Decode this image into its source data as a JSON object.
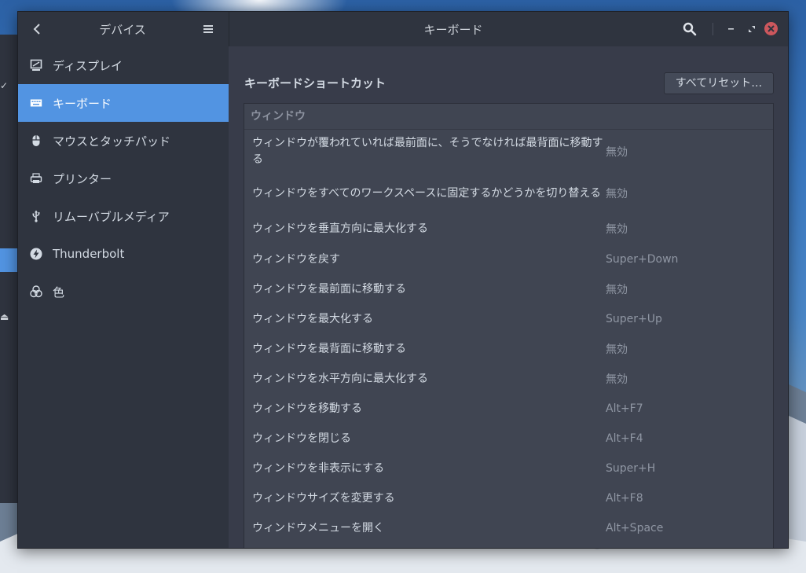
{
  "header": {
    "sidebar_title": "デバイス",
    "title": "キーボード"
  },
  "sidebar": {
    "items": [
      {
        "label": "ディスプレイ",
        "icon": "display-icon"
      },
      {
        "label": "キーボード",
        "icon": "keyboard-icon",
        "active": true
      },
      {
        "label": "マウスとタッチパッド",
        "icon": "mouse-icon"
      },
      {
        "label": "プリンター",
        "icon": "printer-icon"
      },
      {
        "label": "リムーバブルメディア",
        "icon": "usb-icon"
      },
      {
        "label": "Thunderbolt",
        "icon": "thunderbolt-icon"
      },
      {
        "label": "色",
        "icon": "color-icon"
      }
    ]
  },
  "main": {
    "section_title": "キーボードショートカット",
    "reset_label": "すべてリセット…",
    "group_header": "ウィンドウ",
    "shortcuts": [
      {
        "name": "ウィンドウが覆われていれば最前面に、そうでなければ最背面に移動する",
        "accel": "無効"
      },
      {
        "name": "ウィンドウをすべてのワークスペースに固定するかどうかを切り替える",
        "accel": "無効"
      },
      {
        "name": "ウィンドウを垂直方向に最大化する",
        "accel": "無効"
      },
      {
        "name": "ウィンドウを戻す",
        "accel": "Super+Down"
      },
      {
        "name": "ウィンドウを最前面に移動する",
        "accel": "無効"
      },
      {
        "name": "ウィンドウを最大化する",
        "accel": "Super+Up"
      },
      {
        "name": "ウィンドウを最背面に移動する",
        "accel": "無効"
      },
      {
        "name": "ウィンドウを水平方向に最大化する",
        "accel": "無効"
      },
      {
        "name": "ウィンドウを移動する",
        "accel": "Alt+F7"
      },
      {
        "name": "ウィンドウを閉じる",
        "accel": "Alt+F4"
      },
      {
        "name": "ウィンドウを非表示にする",
        "accel": "Super+H"
      },
      {
        "name": "ウィンドウサイズを変更する",
        "accel": "Alt+F8"
      },
      {
        "name": "ウィンドウメニューを開く",
        "accel": "Alt+Space"
      }
    ]
  },
  "colors": {
    "accent": "#5294e2",
    "sidebar_bg": "#2f343f",
    "content_bg": "#383c4a",
    "close": "#cc575d"
  }
}
